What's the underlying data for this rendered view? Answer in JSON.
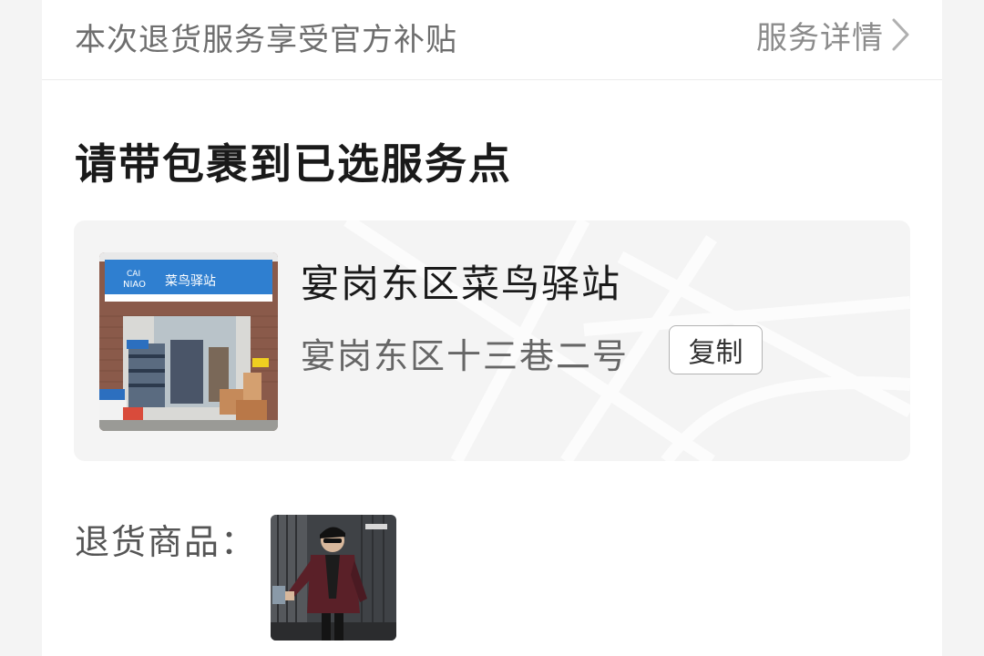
{
  "subsidy": {
    "text": "本次退货服务享受官方补贴",
    "service_link": "服务详情",
    "chevron_icon": "chevron-right-icon"
  },
  "section": {
    "title": "请带包裹到已选服务点"
  },
  "station": {
    "name": "宴岗东区菜鸟驿站",
    "address": "宴岗东区十三巷二号",
    "copy_label": "复制",
    "photo": {
      "sign_top": "CAI",
      "sign_bottom": "NIAO",
      "sign_name": "菜鸟驿站"
    }
  },
  "return_items": {
    "label": "退货商品："
  },
  "colors": {
    "page_bg": "#f4f4f4",
    "card_bg": "#ffffff",
    "station_card_bg": "#f4f4f4",
    "sign_blue": "#2f7fd0"
  }
}
